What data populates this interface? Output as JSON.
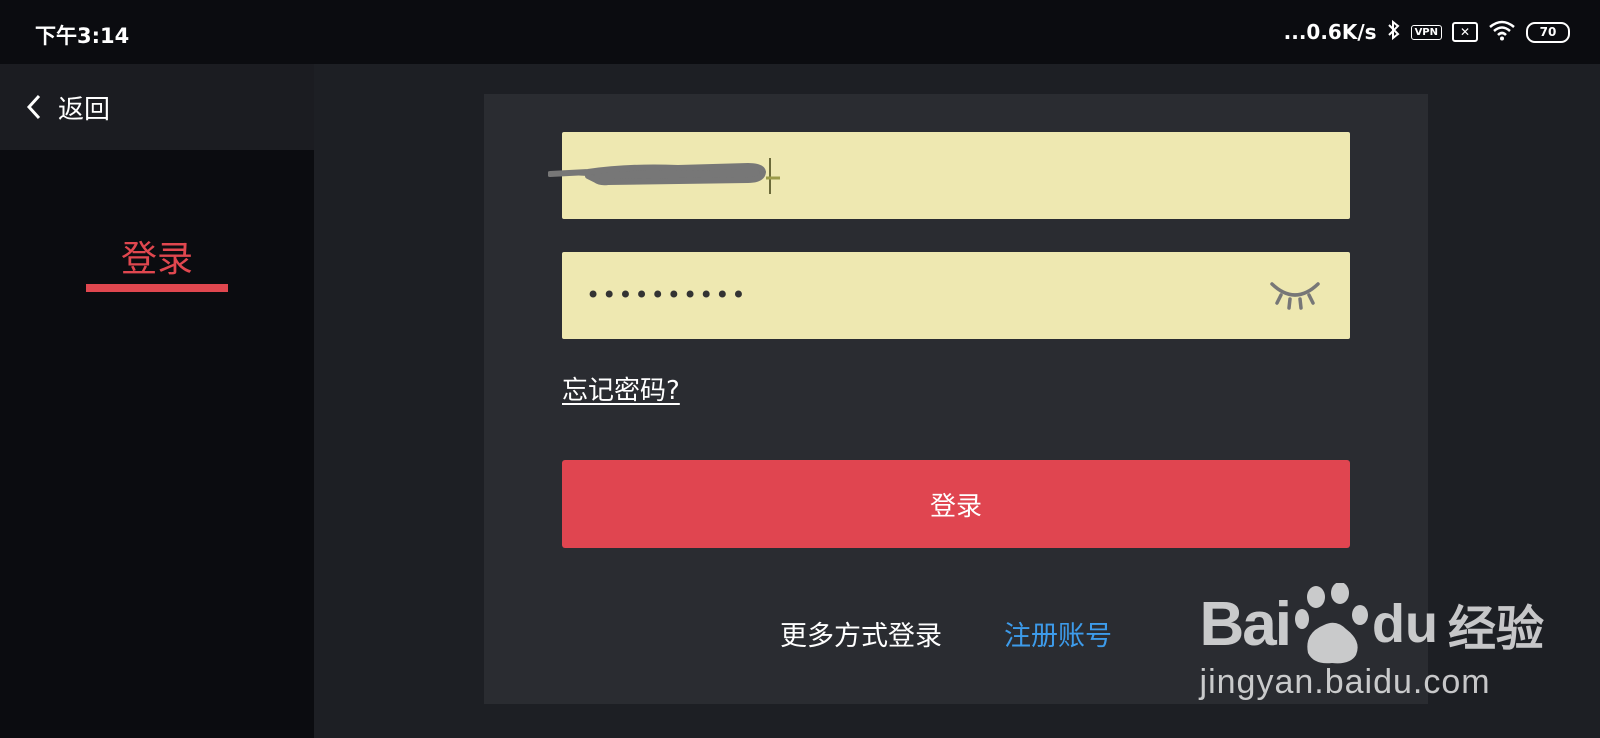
{
  "status_bar": {
    "time": "下午3:14",
    "network_speed": "...0.6K/s",
    "vpn_label": "VPN",
    "battery": "70"
  },
  "sidebar": {
    "back_label": "返回",
    "tab_label": "登录",
    "accent_color": "#e0474f"
  },
  "form": {
    "username_value": "",
    "password_value": "••••••••••",
    "forgot_password": "忘记密码?",
    "login_button": "登录",
    "more_login": "更多方式登录",
    "register": "注册账号",
    "field_color": "#eee8b1",
    "button_color": "#e04550",
    "link_color": "#3d9bea"
  },
  "watermark": {
    "brand": "Bai",
    "brand_du": "du",
    "brand_cn": "经验",
    "url": "jingyan.baidu.com"
  },
  "icons": [
    "back-chevron-icon",
    "bluetooth-icon",
    "vpn-icon",
    "sim-error-icon",
    "wifi-icon",
    "battery-icon",
    "eye-closed-icon",
    "baidu-paw-icon"
  ]
}
